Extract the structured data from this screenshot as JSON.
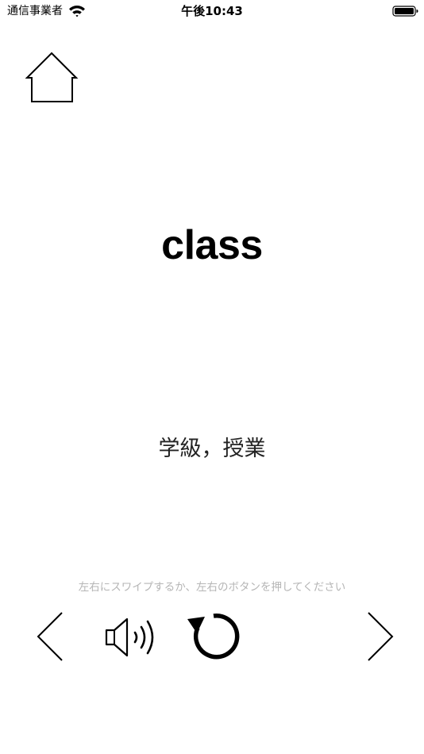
{
  "status_bar": {
    "carrier": "通信事業者",
    "time": "午後10:43",
    "wifi_icon": "wifi-icon",
    "battery_icon": "battery-full-icon"
  },
  "nav": {
    "home_icon": "house-icon"
  },
  "card": {
    "word": "class",
    "meaning": "学級，授業"
  },
  "controls": {
    "hint": "左右にスワイプするか、左右のボタンを押してください",
    "prev_icon": "chevron-left-icon",
    "speaker_icon": "speaker-wave-icon",
    "replay_icon": "rotate-icon",
    "next_icon": "chevron-right-icon"
  }
}
